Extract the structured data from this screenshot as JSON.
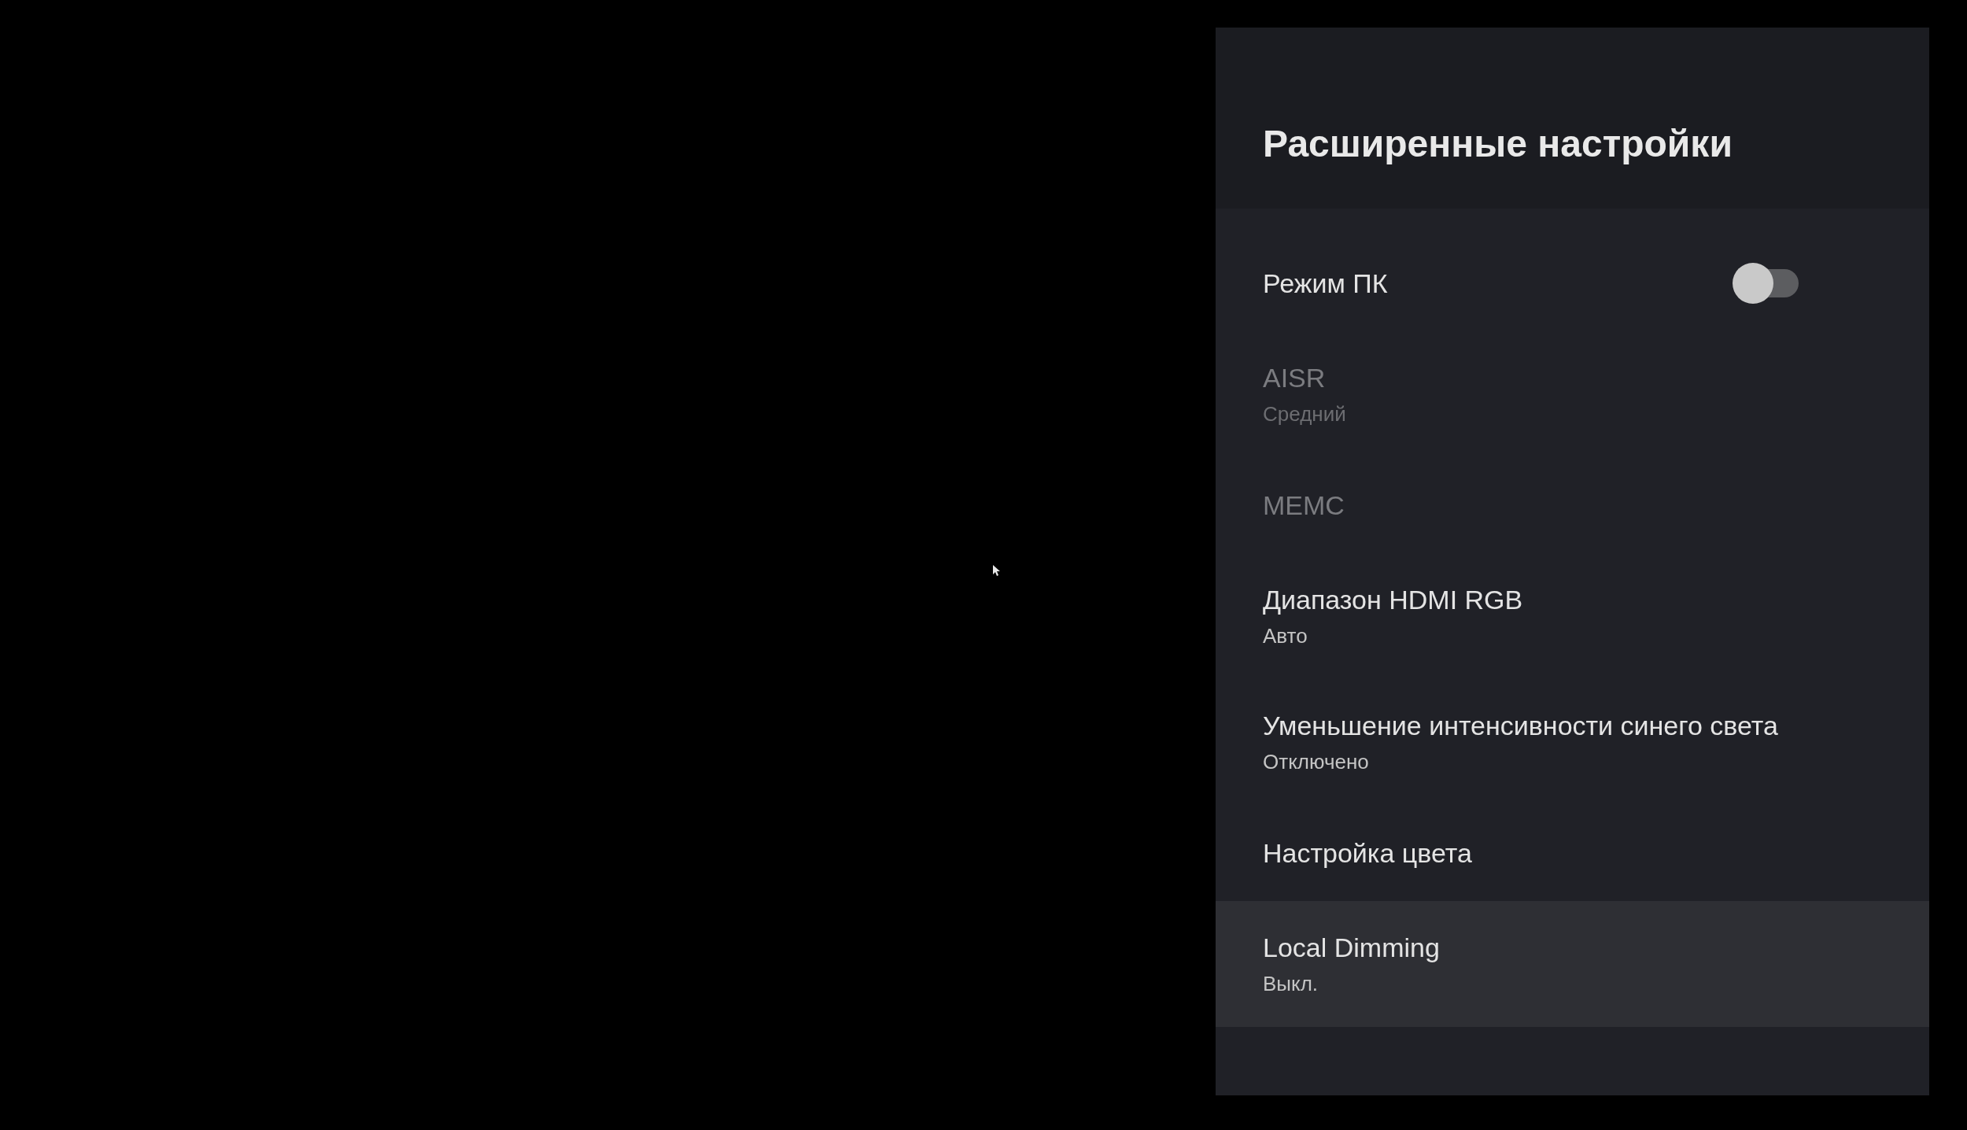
{
  "panel": {
    "title": "Расширенные настройки",
    "items": [
      {
        "kind": "toggle",
        "title": "Режим ПК",
        "on": false,
        "disabled": false,
        "selected": false
      },
      {
        "kind": "option",
        "title": "AISR",
        "value": "Средний",
        "disabled": true,
        "selected": false
      },
      {
        "kind": "option",
        "title": "MEMC",
        "disabled": true,
        "selected": false
      },
      {
        "kind": "option",
        "title": "Диапазон HDMI RGB",
        "value": "Авто",
        "disabled": false,
        "selected": false
      },
      {
        "kind": "option",
        "title": "Уменьшение интенсивности синего света",
        "value": "Отключено",
        "disabled": false,
        "selected": false
      },
      {
        "kind": "option",
        "title": "Настройка цвета",
        "disabled": false,
        "selected": false
      },
      {
        "kind": "option",
        "title": "Local Dimming",
        "value": "Выкл.",
        "disabled": false,
        "selected": true
      }
    ]
  }
}
